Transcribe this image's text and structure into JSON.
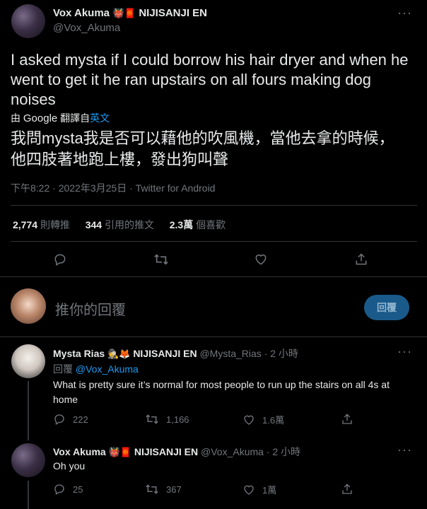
{
  "main_tweet": {
    "display_name": "Vox Akuma",
    "emoji": "👹🧧",
    "org": "NIJISANJI EN",
    "handle": "@Vox_Akuma",
    "text": "I asked mysta if I could borrow his hair dryer and when he went to get it he ran upstairs on all fours making dog noises",
    "translate_prefix": "由",
    "translate_google": "Google",
    "translate_mid": "翻譯自",
    "translate_lang": "英文",
    "translated_text": "我問mysta我是否可以藉他的吹風機，當他去拿的時候，他四肢著地跑上樓，發出狗叫聲",
    "meta": "下午8:22 · 2022年3月25日 · Twitter for Android",
    "retweets_count": "2,774",
    "retweets_label": "則轉推",
    "quotes_count": "344",
    "quotes_label": "引用的推文",
    "likes_count": "2.3萬",
    "likes_label": "個喜歡"
  },
  "compose": {
    "placeholder": "推你的回覆",
    "button": "回覆"
  },
  "replies": [
    {
      "display_name": "Mysta Rias",
      "emoji": "🕵🦊",
      "org": "NIJISANJI EN",
      "handle": "@Mysta_Rias",
      "time": "· 2 小時",
      "reply_prefix": "回覆",
      "reply_to": "@Vox_Akuma",
      "text": "What is pretty sure it’s normal for most people to run up the stairs on all 4s at home",
      "replies": "222",
      "retweets": "1,166",
      "likes": "1.6萬"
    },
    {
      "display_name": "Vox Akuma",
      "emoji": "👹🧧",
      "org": "NIJISANJI EN",
      "handle": "@Vox_Akuma",
      "time": "· 2 小時",
      "text": "Oh you",
      "replies": "25",
      "retweets": "367",
      "likes": "1萬"
    }
  ],
  "icons": {
    "more": "more-icon",
    "reply": "reply-icon",
    "retweet": "retweet-icon",
    "like": "like-icon",
    "share": "share-icon"
  },
  "colors": {
    "background": "#000000",
    "text": "#e7e9ea",
    "muted": "#71767b",
    "accent": "#1d9bf0",
    "divider": "#2f3336"
  }
}
